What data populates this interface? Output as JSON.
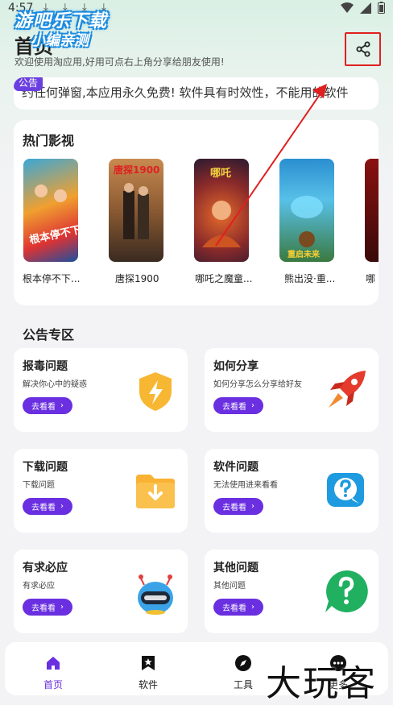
{
  "status": {
    "time": "4:57",
    "download_icons": [
      "download-icon",
      "download-icon",
      "download-icon",
      "download-icon"
    ]
  },
  "watermark": {
    "line1": "游吧乐下载",
    "line2": "小编亲测",
    "bottom": "大玩客"
  },
  "header": {
    "title": "首页",
    "subtitle": "欢迎使用淘应用,好用可点右上角分享给朋友使用!",
    "share_icon": "share-icon"
  },
  "notice": {
    "tag": "公告",
    "text": "约任何弹窗,本应用永久免费!   软件具有时效性，不能用的软件"
  },
  "hot": {
    "title": "热门影视",
    "items": [
      {
        "label": "根本停不下..."
      },
      {
        "label": "唐探1900"
      },
      {
        "label": "哪吒之魔童..."
      },
      {
        "label": "熊出没·重..."
      },
      {
        "label": "哪"
      }
    ]
  },
  "announcements": {
    "title": "公告专区",
    "cards": [
      {
        "title": "报毒问题",
        "desc": "解决你心中的疑惑",
        "button": "去看看",
        "icon": "shield-lightning-icon"
      },
      {
        "title": "如何分享",
        "desc": "如何分享怎么分享给好友",
        "button": "去看看",
        "icon": "rocket-icon"
      },
      {
        "title": "下载问题",
        "desc": "下载问题",
        "button": "去看看",
        "icon": "folder-download-icon"
      },
      {
        "title": "软件问题",
        "desc": "无法使用进来看看",
        "button": "去看看",
        "icon": "chat-question-icon"
      },
      {
        "title": "有求必应",
        "desc": "有求必应",
        "button": "去看看",
        "icon": "robot-icon"
      },
      {
        "title": "其他问题",
        "desc": "其他问题",
        "button": "去看看",
        "icon": "question-bubble-icon"
      }
    ]
  },
  "tabs": [
    {
      "label": "首页",
      "icon": "home-icon",
      "active": true
    },
    {
      "label": "软件",
      "icon": "bookmark-star-icon"
    },
    {
      "label": "工具",
      "icon": "compass-icon"
    },
    {
      "label": "更多",
      "icon": "more-icon"
    }
  ],
  "colors": {
    "accent": "#6a2fe0",
    "highlight": "#e02020"
  }
}
